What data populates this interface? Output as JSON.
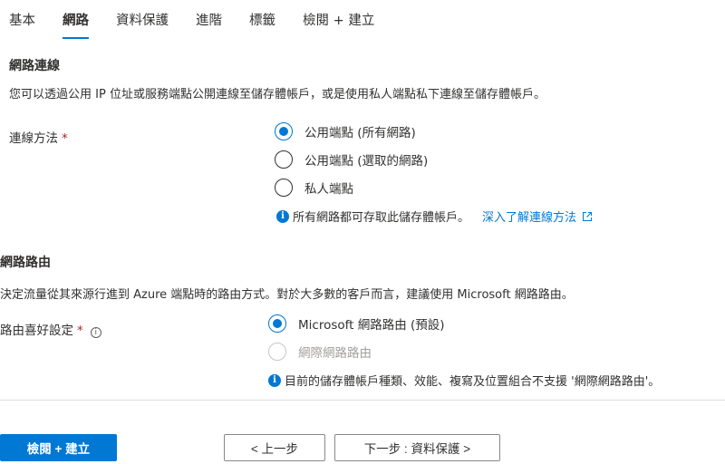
{
  "tabs": [
    {
      "label": "基本"
    },
    {
      "label": "網路",
      "active": true
    },
    {
      "label": "資料保護"
    },
    {
      "label": "進階"
    },
    {
      "label": "標籤"
    },
    {
      "label": "檢閱 + 建立"
    }
  ],
  "connectivity": {
    "title": "網路連線",
    "description": "您可以透過公用 IP 位址或服務端點公開連線至儲存體帳戶，或是使用私人端點私下連線至儲存體帳戶。",
    "field_label": "連線方法",
    "required_mark": "*",
    "options": [
      {
        "label": "公用端點 (所有網路)",
        "selected": true
      },
      {
        "label": "公用端點 (選取的網路)",
        "selected": false
      },
      {
        "label": "私人端點",
        "selected": false
      }
    ],
    "note": "所有網路都可存取此儲存體帳戶。",
    "link": "深入了解連線方法",
    "info_icon": "info-filled-icon",
    "external_icon": "external-link-icon"
  },
  "routing": {
    "title": "網路路由",
    "description": "決定流量從其來源行進到 Azure 端點時的路由方式。對於大多數的客戶而言，建議使用 Microsoft 網路路由。",
    "field_label": "路由喜好設定",
    "required_mark": "*",
    "tooltip_icon": "i",
    "options": [
      {
        "label": "Microsoft 網路路由 (預設)",
        "selected": true,
        "disabled": false
      },
      {
        "label": "網際網路路由",
        "selected": false,
        "disabled": true
      }
    ],
    "note": "目前的儲存體帳戶種類、效能、複寫及位置組合不支援 '網際網路路由'。"
  },
  "footer": {
    "review_create": "檢閱 + 建立",
    "previous": "< 上一步",
    "next": "下一步 : 資料保護 >"
  },
  "colors": {
    "accent": "#0078d4",
    "required": "#a4262c",
    "text": "#323130",
    "disabled": "#a19f9d"
  }
}
